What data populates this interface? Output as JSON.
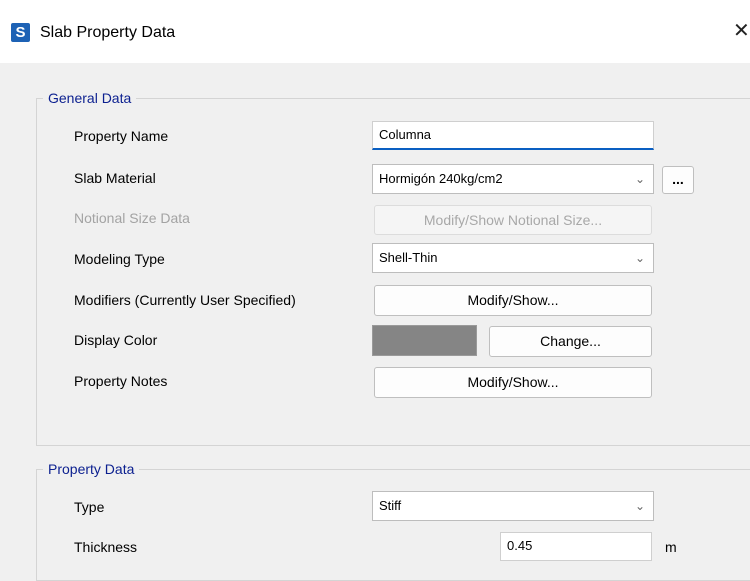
{
  "window": {
    "title": "Slab Property Data",
    "icon_letter": "S",
    "close_glyph": "✕"
  },
  "general": {
    "legend": "General Data",
    "property_name": {
      "label": "Property Name",
      "value": "Columna"
    },
    "slab_material": {
      "label": "Slab Material",
      "value": "Hormigón 240kg/cm2",
      "browse": "..."
    },
    "notional": {
      "label": "Notional Size Data",
      "button": "Modify/Show Notional Size..."
    },
    "modeling_type": {
      "label": "Modeling Type",
      "value": "Shell-Thin"
    },
    "modifiers": {
      "label": "Modifiers (Currently User Specified)",
      "button": "Modify/Show..."
    },
    "display_color": {
      "label": "Display Color",
      "button": "Change...",
      "color": "#858585"
    },
    "property_notes": {
      "label": "Property Notes",
      "button": "Modify/Show..."
    }
  },
  "property": {
    "legend": "Property Data",
    "type": {
      "label": "Type",
      "value": "Stiff"
    },
    "thickness": {
      "label": "Thickness",
      "value": "0.45",
      "unit": "m"
    }
  },
  "icons": {
    "chevron": "chevron-down-icon",
    "close": "close-icon"
  }
}
